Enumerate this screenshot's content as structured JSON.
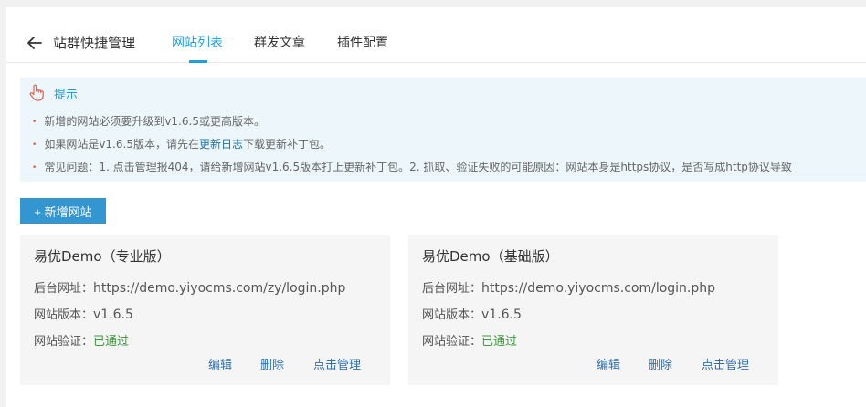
{
  "header": {
    "title": "站群快捷管理",
    "tabs": [
      {
        "label": "网站列表",
        "active": true
      },
      {
        "label": "群发文章",
        "active": false
      },
      {
        "label": "插件配置",
        "active": false
      }
    ],
    "back_icon": "arrow-left-icon"
  },
  "tip": {
    "title": "提示",
    "icon": "pointing-hand-icon",
    "lines": [
      {
        "text": "新增的网站必须要升级到v1.6.5或更高版本。"
      },
      {
        "pre": "如果网站是v1.6.5版本，请先在",
        "link": "更新日志",
        "post": "下载更新补丁包。"
      },
      {
        "text": "常见问题：1. 点击管理报404，请给新增网站v1.6.5版本打上更新补丁包。2. 抓取、验证失败的可能原因：网站本身是https协议，是否写成http协议导致"
      }
    ]
  },
  "add_button": {
    "label": "+ 新增网站"
  },
  "sites": [
    {
      "title": "易优Demo（专业版）",
      "backend_label": "后台网址：",
      "backend_url": "https://demo.yiyocms.com/zy/login.php",
      "version_label": "网站版本：",
      "version": "v1.6.5",
      "verify_label": "网站验证：",
      "verify_status": "已通过",
      "actions": {
        "edit": "编辑",
        "delete": "删除",
        "manage": "点击管理"
      }
    },
    {
      "title": "易优Demo（基础版）",
      "backend_label": "后台网址：",
      "backend_url": "https://demo.yiyocms.com/login.php",
      "version_label": "网站版本：",
      "version": "v1.6.5",
      "verify_label": "网站验证：",
      "verify_status": "已通过",
      "actions": {
        "edit": "编辑",
        "delete": "删除",
        "manage": "点击管理"
      }
    }
  ],
  "colors": {
    "accent": "#1e9fdf",
    "button": "#3496d1",
    "tip_bg": "#ecf6fb",
    "verified": "#3a9a3a",
    "link": "#2f6fb0"
  }
}
